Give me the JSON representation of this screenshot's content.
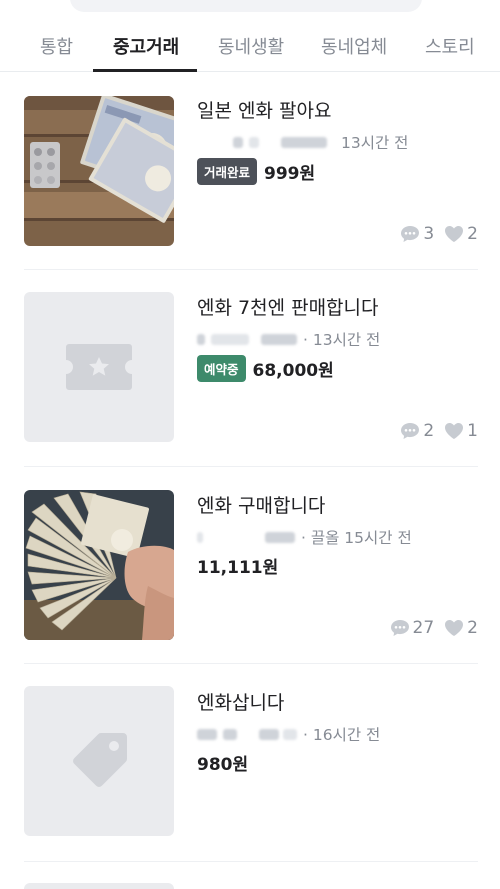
{
  "tabs": [
    {
      "label": "통합"
    },
    {
      "label": "중고거래",
      "active": true
    },
    {
      "label": "동네생활"
    },
    {
      "label": "동네업체"
    },
    {
      "label": "스토리"
    }
  ],
  "listings": [
    {
      "title": "일본 엔화 팔아요",
      "meta_suffix": "13시간 전",
      "badge": "거래완료",
      "price": "999원",
      "comments": "3",
      "likes": "2",
      "thumbnail": "yen-photo"
    },
    {
      "title": "엔화 7천엔 판매합니다",
      "meta_suffix": "· 13시간 전",
      "badge": "예약중",
      "price": "68,000원",
      "comments": "2",
      "likes": "1",
      "thumbnail": "ticket-placeholder-icon"
    },
    {
      "title": "엔화 구매합니다",
      "meta_suffix": "· 끌올 15시간 전",
      "price": "11,111원",
      "comments": "27",
      "likes": "2",
      "thumbnail": "yen-fan-photo"
    },
    {
      "title": "엔화삽니다",
      "meta_suffix": "· 16시간 전",
      "price": "980원",
      "thumbnail": "tag-placeholder-icon"
    }
  ],
  "colors": {
    "badge_done": "#4d5159",
    "badge_reserved": "#3d8a6b",
    "placeholder_bg": "#eaebee",
    "muted_text": "#868b94"
  }
}
